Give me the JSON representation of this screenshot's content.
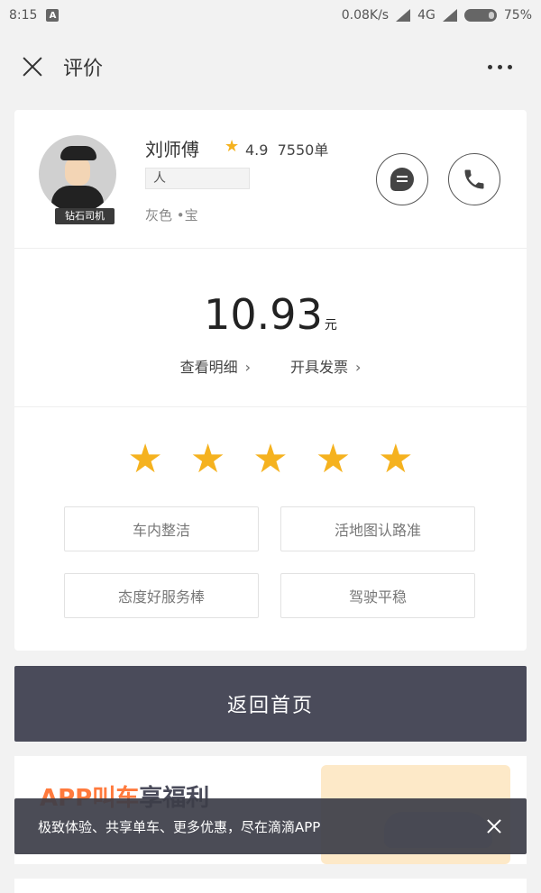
{
  "status_bar": {
    "time": "8:15",
    "a_badge": "A",
    "network_speed": "0.08K/s",
    "network_type": "4G",
    "battery": "75%"
  },
  "nav": {
    "title": "评价",
    "close_icon": "close-icon",
    "more_icon": "more-dots-icon"
  },
  "driver": {
    "name": "刘师傅",
    "rating": "4.9",
    "orders": "7550单",
    "plate": "人",
    "car_desc": "灰色 •宝",
    "badge": "钻石司机"
  },
  "fare": {
    "amount": "10.93",
    "unit": "元",
    "detail_link": "查看明细",
    "invoice_link": "开具发票"
  },
  "rating": {
    "stars": 5,
    "max_stars": 5
  },
  "tags": [
    "车内整洁",
    "活地图认路准",
    "态度好服务棒",
    "驾驶平稳"
  ],
  "home_button": "返回首页",
  "promo": {
    "title_orange": "APP叫车",
    "title_dark": "享福利"
  },
  "toast": {
    "text": "极致体验、共享单车、更多优惠，尽在滴滴APP"
  },
  "colors": {
    "accent_star": "#f5b21f",
    "button_dark": "#4a4b5a",
    "promo_orange": "#ff7a3d"
  }
}
